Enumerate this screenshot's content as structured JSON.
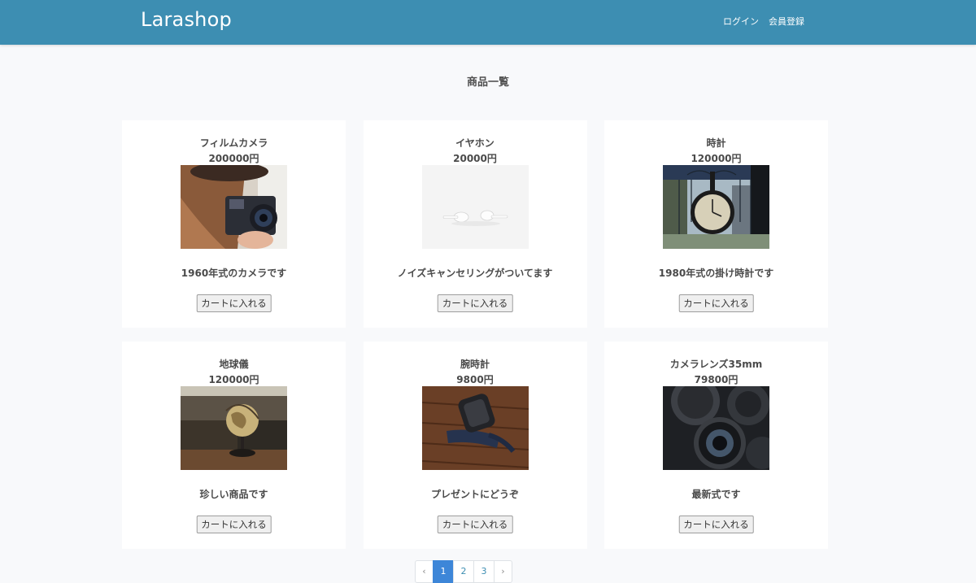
{
  "header": {
    "brand": "Larashop",
    "links": [
      "ログイン",
      "会員登録"
    ],
    "color": "#3d8eb2"
  },
  "page": {
    "title": "商品一覧"
  },
  "products": [
    {
      "name": "フィルムカメラ",
      "price": "200000円",
      "description": "1960年式のカメラです",
      "button": "カートに入れる"
    },
    {
      "name": "イヤホン",
      "price": "20000円",
      "description": "ノイズキャンセリングがついてます",
      "button": "カートに入れる"
    },
    {
      "name": "時計",
      "price": "120000円",
      "description": "1980年式の掛け時計です",
      "button": "カートに入れる"
    },
    {
      "name": "地球儀",
      "price": "120000円",
      "description": "珍しい商品です",
      "button": "カートに入れる"
    },
    {
      "name": "腕時計",
      "price": "9800円",
      "description": "プレゼントにどうぞ",
      "button": "カートに入れる"
    },
    {
      "name": "カメラレンズ35mm",
      "price": "79800円",
      "description": "最新式です",
      "button": "カートに入れる"
    }
  ],
  "pagination": {
    "prev": "‹",
    "pages": [
      "1",
      "2",
      "3"
    ],
    "next": "›",
    "active": "1"
  }
}
